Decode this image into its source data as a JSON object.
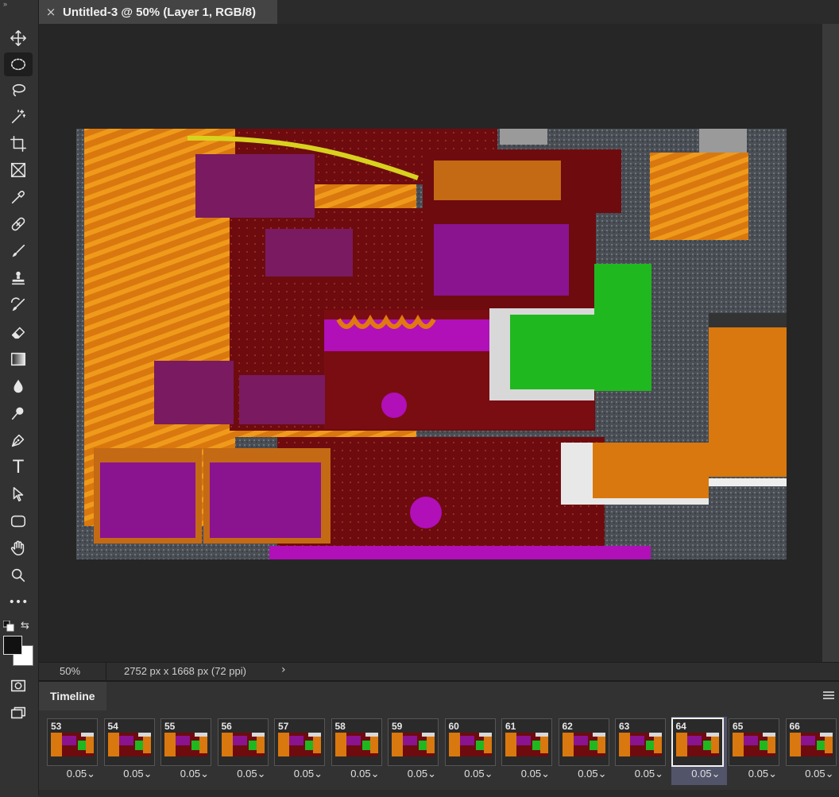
{
  "document_tab": {
    "close_glyph": "×",
    "title": "Untitled-3 @ 50% (Layer 1, RGB/8)"
  },
  "tools": [
    {
      "name": "move-tool",
      "icon": "move-icon"
    },
    {
      "name": "elliptical-marquee-tool",
      "icon": "ellipse-marquee-icon",
      "active": true
    },
    {
      "name": "lasso-tool",
      "icon": "lasso-icon"
    },
    {
      "name": "magic-wand-tool",
      "icon": "magic-wand-icon"
    },
    {
      "name": "crop-tool",
      "icon": "crop-icon"
    },
    {
      "name": "frame-tool",
      "icon": "frame-icon"
    },
    {
      "name": "eyedropper-tool",
      "icon": "eyedropper-icon"
    },
    {
      "name": "healing-brush-tool",
      "icon": "bandage-icon"
    },
    {
      "name": "brush-tool",
      "icon": "brush-icon"
    },
    {
      "name": "clone-stamp-tool",
      "icon": "stamp-icon"
    },
    {
      "name": "history-brush-tool",
      "icon": "history-brush-icon"
    },
    {
      "name": "eraser-tool",
      "icon": "eraser-icon"
    },
    {
      "name": "gradient-tool",
      "icon": "gradient-icon"
    },
    {
      "name": "blur-tool",
      "icon": "drop-icon"
    },
    {
      "name": "dodge-tool",
      "icon": "dodge-icon"
    },
    {
      "name": "pen-tool",
      "icon": "pen-icon"
    },
    {
      "name": "type-tool",
      "icon": "type-icon",
      "glyph": "T"
    },
    {
      "name": "path-selection-tool",
      "icon": "arrow-icon"
    },
    {
      "name": "rectangle-tool",
      "icon": "rounded-rect-icon"
    },
    {
      "name": "hand-tool",
      "icon": "hand-icon"
    },
    {
      "name": "zoom-tool",
      "icon": "zoom-icon"
    },
    {
      "name": "edit-toolbar",
      "icon": "more-icon",
      "glyph": "•••"
    }
  ],
  "colors": {
    "foreground": "#111111",
    "background": "#ffffff"
  },
  "status": {
    "zoom": "50%",
    "doc_size": "2752 px x 1668 px (72 ppi)",
    "arrow": "›"
  },
  "timeline": {
    "title": "Timeline",
    "frames": [
      {
        "number": "53",
        "delay": "0.05"
      },
      {
        "number": "54",
        "delay": "0.05"
      },
      {
        "number": "55",
        "delay": "0.05"
      },
      {
        "number": "56",
        "delay": "0.05"
      },
      {
        "number": "57",
        "delay": "0.05"
      },
      {
        "number": "58",
        "delay": "0.05"
      },
      {
        "number": "59",
        "delay": "0.05"
      },
      {
        "number": "60",
        "delay": "0.05"
      },
      {
        "number": "61",
        "delay": "0.05"
      },
      {
        "number": "62",
        "delay": "0.05"
      },
      {
        "number": "63",
        "delay": "0.05"
      },
      {
        "number": "64",
        "delay": "0.05",
        "selected": true
      },
      {
        "number": "65",
        "delay": "0.05"
      },
      {
        "number": "66",
        "delay": "0.05"
      }
    ]
  }
}
